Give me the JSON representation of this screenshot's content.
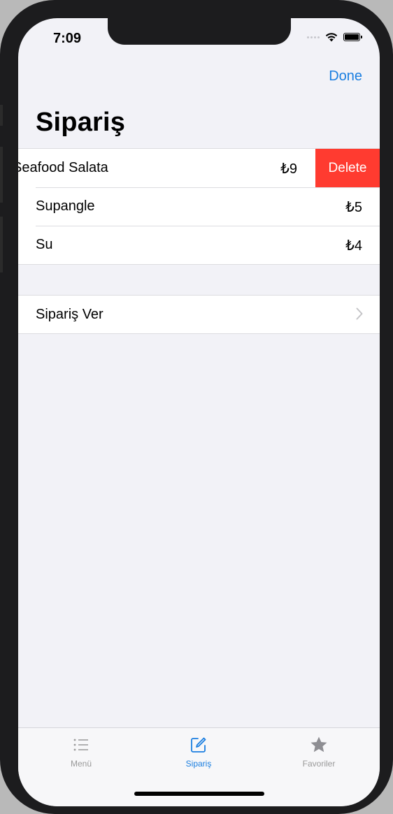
{
  "status_bar": {
    "time": "7:09"
  },
  "nav": {
    "done_label": "Done",
    "title": "Sipariş"
  },
  "order_items": [
    {
      "name": "Seafood Salata",
      "price": "₺9",
      "swiped": true
    },
    {
      "name": "Supangle",
      "price": "₺5"
    },
    {
      "name": "Su",
      "price": "₺4"
    }
  ],
  "row_actions": {
    "delete_label": "Delete"
  },
  "place_order": {
    "label": "Sipariş Ver"
  },
  "tab_bar": {
    "tabs": [
      {
        "label": "Menü",
        "icon": "list-icon",
        "active": false
      },
      {
        "label": "Sipariş",
        "icon": "compose-icon",
        "active": true
      },
      {
        "label": "Favoriler",
        "icon": "star-icon",
        "active": false
      }
    ]
  },
  "colors": {
    "accent": "#1a7ee0",
    "destructive": "#ff3b30",
    "background": "#f2f2f7"
  }
}
